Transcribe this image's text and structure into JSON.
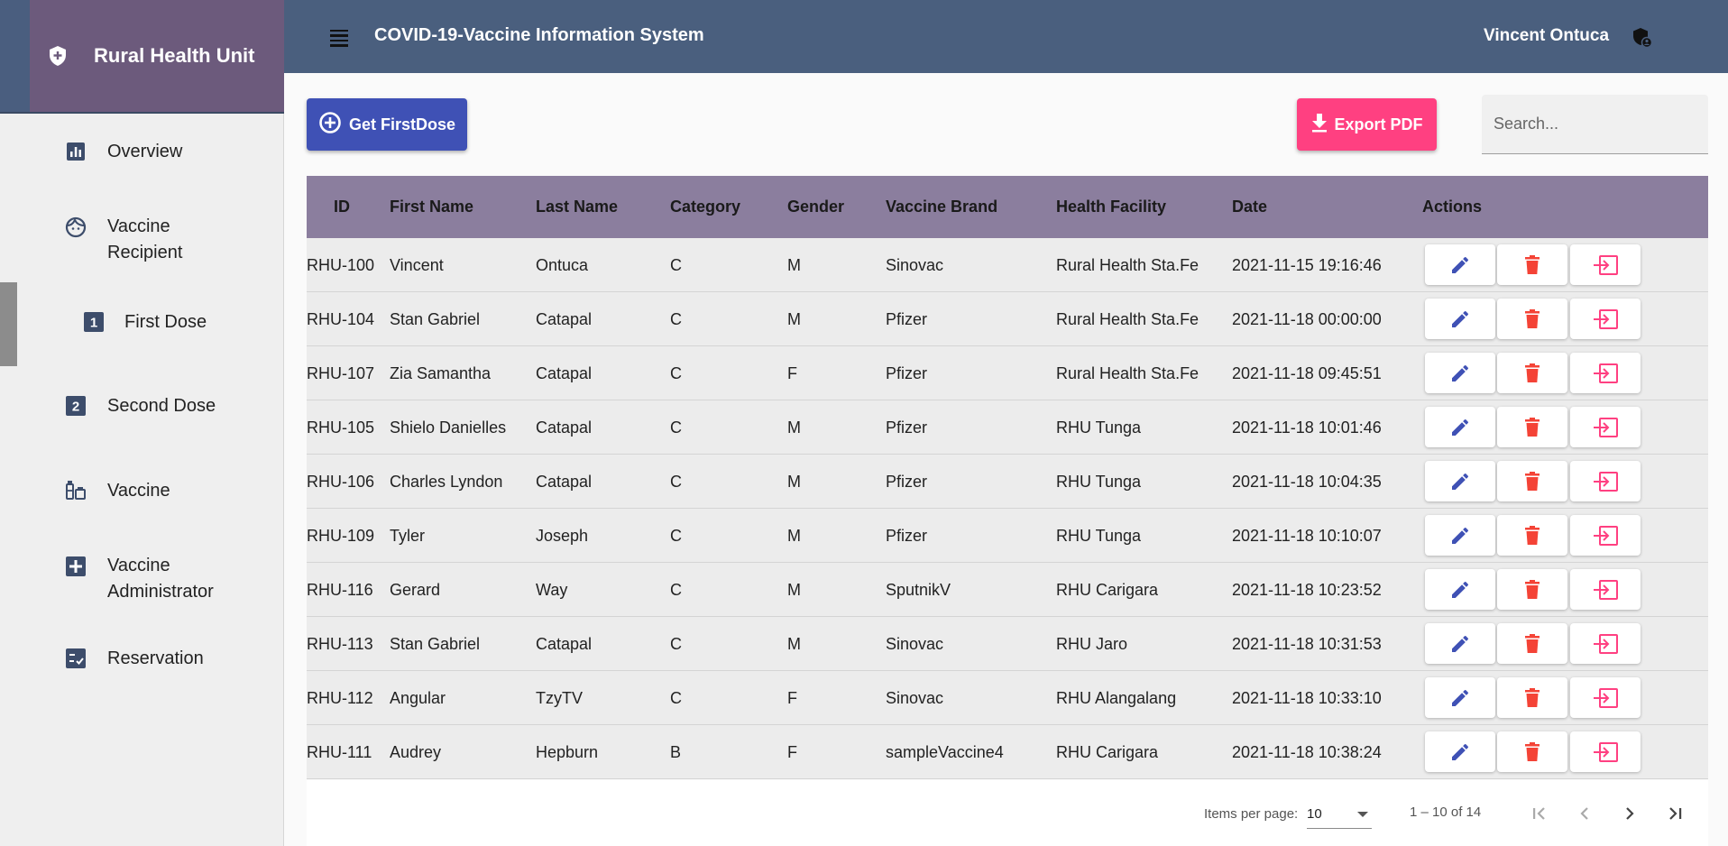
{
  "sidebar": {
    "brand": "Rural Health Unit",
    "items": [
      {
        "label": "Overview",
        "icon": "chart-icon"
      },
      {
        "label": "Vaccine",
        "label2": "Recipient",
        "icon": "face-icon"
      },
      {
        "label": "First Dose",
        "icon": "looks-one-icon"
      },
      {
        "label": "Second Dose",
        "icon": "looks-two-icon"
      },
      {
        "label": "Vaccine",
        "icon": "vaccine-icon"
      },
      {
        "label": "Vaccine",
        "label2": "Administrator",
        "icon": "medical-cross-icon"
      },
      {
        "label": "Reservation",
        "icon": "checklist-icon"
      }
    ]
  },
  "header": {
    "title": "COVID-19-Vaccine Information System",
    "user": "Vincent Ontuca"
  },
  "toolbar": {
    "first_dose_label": "Get FirstDose",
    "export_label": "Export PDF",
    "search_placeholder": "Search..."
  },
  "table": {
    "columns": [
      "ID",
      "First Name",
      "Last Name",
      "Category",
      "Gender",
      "Vaccine Brand",
      "Health Facility",
      "Date",
      "Actions"
    ],
    "rows": [
      [
        "RHU-100",
        "Vincent",
        "Ontuca",
        "C",
        "M",
        "Sinovac",
        "Rural Health Sta.Fe",
        "2021-11-15 19:16:46"
      ],
      [
        "RHU-104",
        "Stan Gabriel",
        "Catapal",
        "C",
        "M",
        "Pfizer",
        "Rural Health Sta.Fe",
        "2021-11-18 00:00:00"
      ],
      [
        "RHU-107",
        "Zia Samantha",
        "Catapal",
        "C",
        "F",
        "Pfizer",
        "Rural Health Sta.Fe",
        "2021-11-18 09:45:51"
      ],
      [
        "RHU-105",
        "Shielo Danielles",
        "Catapal",
        "C",
        "M",
        "Pfizer",
        "RHU Tunga",
        "2021-11-18 10:01:46"
      ],
      [
        "RHU-106",
        "Charles Lyndon",
        "Catapal",
        "C",
        "M",
        "Pfizer",
        "RHU Tunga",
        "2021-11-18 10:04:35"
      ],
      [
        "RHU-109",
        "Tyler",
        "Joseph",
        "C",
        "M",
        "Pfizer",
        "RHU Tunga",
        "2021-11-18 10:10:07"
      ],
      [
        "RHU-116",
        "Gerard",
        "Way",
        "C",
        "M",
        "SputnikV",
        "RHU Carigara",
        "2021-11-18 10:23:52"
      ],
      [
        "RHU-113",
        "Stan Gabriel",
        "Catapal",
        "C",
        "M",
        "Sinovac",
        "RHU Jaro",
        "2021-11-18 10:31:53"
      ],
      [
        "RHU-112",
        "Angular",
        "TzyTV",
        "C",
        "F",
        "Sinovac",
        "RHU Alangalang",
        "2021-11-18 10:33:10"
      ],
      [
        "RHU-111",
        "Audrey",
        "Hepburn",
        "B",
        "F",
        "sampleVaccine4",
        "RHU Carigara",
        "2021-11-18 10:38:24"
      ]
    ]
  },
  "paginator": {
    "items_per_page_label": "Items per page:",
    "page_size": "10",
    "range": "1 – 10 of 14"
  },
  "colors": {
    "primary": "#3f51b5",
    "accent": "#ff4081",
    "delete": "#f44336",
    "header_bg": "#4a5f7e",
    "table_header": "#8b7e9e",
    "brand_bg": "#6c5a7c"
  }
}
